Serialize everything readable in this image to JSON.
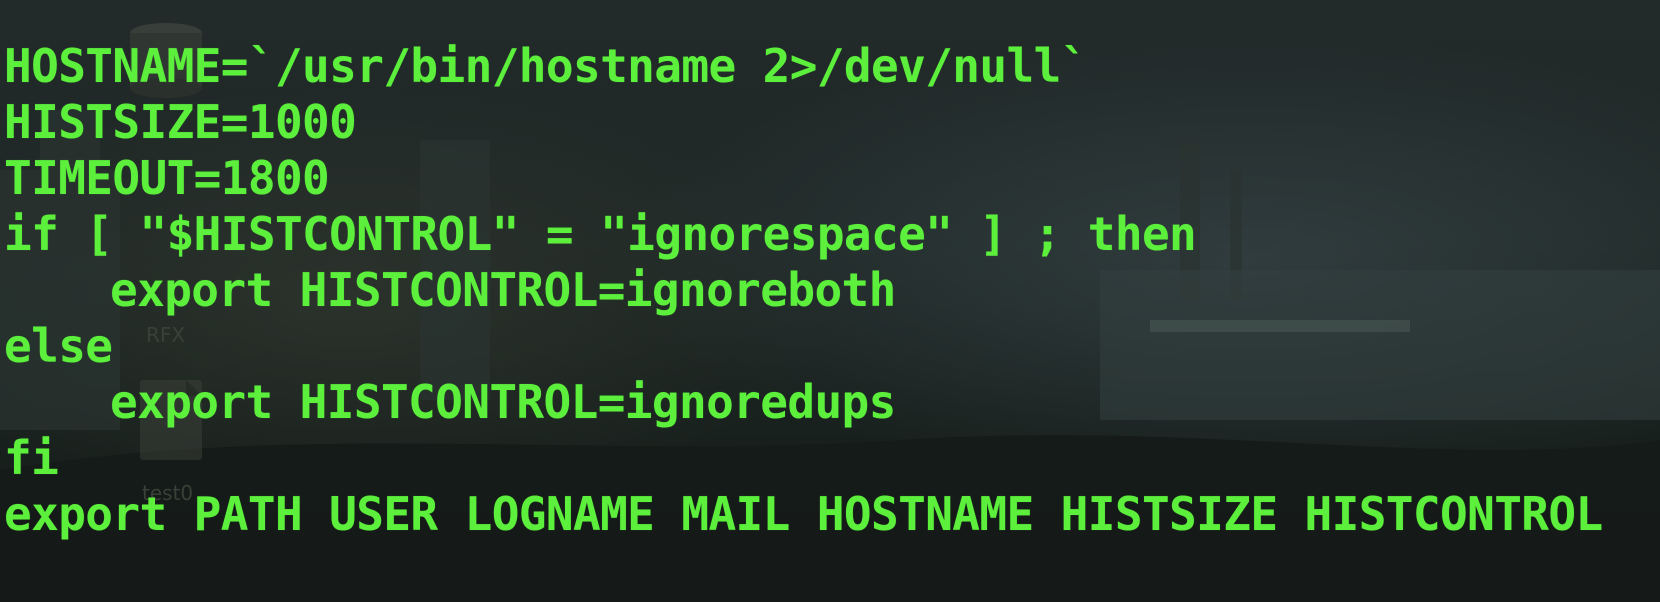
{
  "terminal": {
    "lines": {
      "l1": "HOSTNAME=`/usr/bin/hostname 2>/dev/null`",
      "l2": "HISTSIZE=1000",
      "l3": "TIMEOUT=1800",
      "l4": "if [ \"$HISTCONTROL\" = \"ignorespace\" ] ; then",
      "l5": "export HISTCONTROL=ignoreboth",
      "l6": "else",
      "l7": "export HISTCONTROL=ignoredups",
      "l8": "fi",
      "l9": "export PATH USER LOGNAME MAIL HOSTNAME HISTSIZE HISTCONTROL"
    },
    "text_color": "#5cf03c"
  },
  "desktop": {
    "icon_labels": {
      "icon1": "RFX",
      "icon2": "test0"
    },
    "icons": [
      "disk-icon",
      "file-icon"
    ]
  }
}
